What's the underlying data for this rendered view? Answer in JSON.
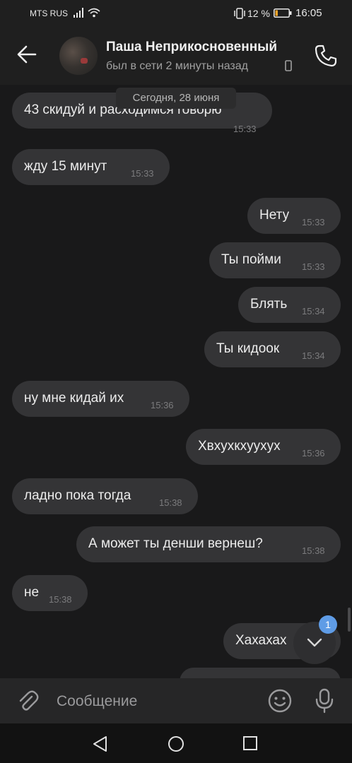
{
  "status_bar": {
    "carrier": "MTS RUS",
    "battery_percent": "12 %",
    "time": "16:05",
    "icons": [
      "signal-icon",
      "wifi-icon",
      "vibrate-icon",
      "battery-icon"
    ]
  },
  "header": {
    "contact_name": "Паша Неприкосновенный",
    "status": "был в сети 2 минуты назад",
    "icons": [
      "back-arrow-icon",
      "phone-small-icon",
      "call-icon"
    ]
  },
  "date_chip": "Сегодня, 28 июня",
  "messages": [
    {
      "dir": "in",
      "text": "43 скидуй и расходимся говорю",
      "time": "15:33"
    },
    {
      "dir": "in",
      "text": "жду 15 минут",
      "time": "15:33"
    },
    {
      "dir": "out",
      "text": "Нету",
      "time": "15:33"
    },
    {
      "dir": "out",
      "text": "Ты пойми",
      "time": "15:33"
    },
    {
      "dir": "out",
      "text": "Блять",
      "time": "15:34"
    },
    {
      "dir": "out",
      "text": "Ты кидоок",
      "time": "15:34"
    },
    {
      "dir": "in",
      "text": "ну мне кидай их",
      "time": "15:36"
    },
    {
      "dir": "out",
      "text": "Хвхухкхуухух",
      "time": "15:36"
    },
    {
      "dir": "in",
      "text": "ладно пока тогда",
      "time": "15:38"
    },
    {
      "dir": "out",
      "text": "А может ты денши вернеш?",
      "time": "15:38"
    },
    {
      "dir": "in",
      "text": "не",
      "time": "15:38"
    },
    {
      "dir": "out",
      "text": "Хахахах",
      "time": ""
    }
  ],
  "scroll_badge": {
    "count": "1",
    "icon": "chevron-down-icon"
  },
  "composer": {
    "placeholder": "Сообщение",
    "icons": [
      "attach-icon",
      "emoji-icon",
      "mic-icon"
    ]
  },
  "nav_bar": {
    "icons": [
      "nav-back-icon",
      "nav-home-icon",
      "nav-recent-icon"
    ]
  },
  "colors": {
    "background": "#19191a",
    "bubble": "#343436",
    "header": "#1f1f1f",
    "accent": "#5f9ce6"
  }
}
